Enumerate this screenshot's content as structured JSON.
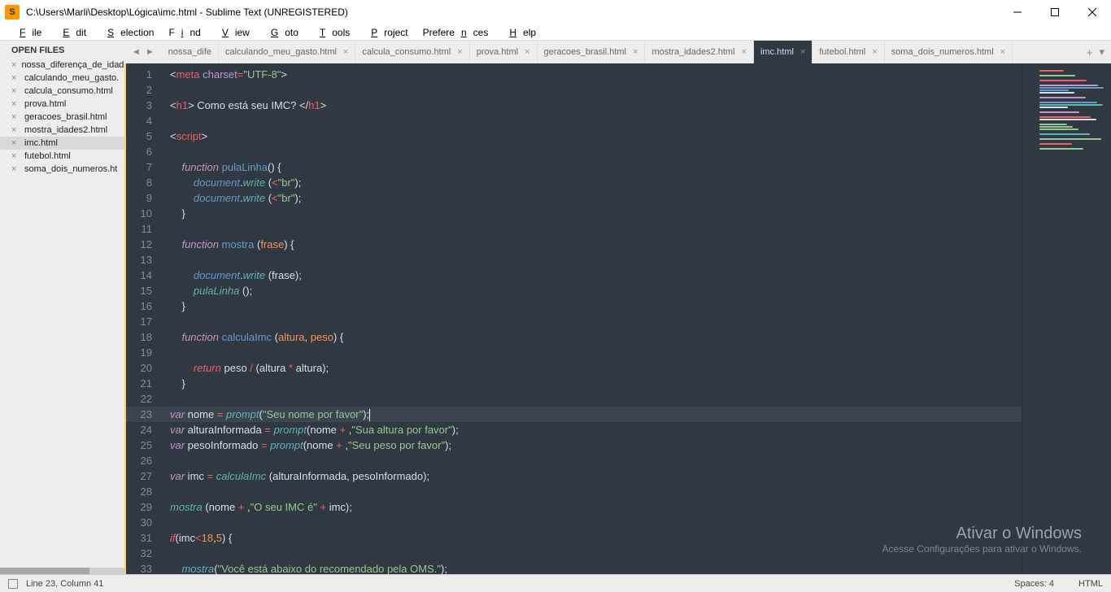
{
  "titlebar": {
    "path": "C:\\Users\\Marli\\Desktop\\Lógica\\imc.html - Sublime Text (UNREGISTERED)"
  },
  "menu": {
    "items": [
      "File",
      "Edit",
      "Selection",
      "Find",
      "View",
      "Goto",
      "Tools",
      "Project",
      "Preferences",
      "Help"
    ]
  },
  "sidebar": {
    "header": "OPEN FILES",
    "files": [
      {
        "name": "nossa_diferença_de_idade",
        "active": false
      },
      {
        "name": "calculando_meu_gasto.",
        "active": false
      },
      {
        "name": "calcula_consumo.html",
        "active": false
      },
      {
        "name": "prova.html",
        "active": false
      },
      {
        "name": "geracoes_brasil.html",
        "active": false
      },
      {
        "name": "mostra_idades2.html",
        "active": false
      },
      {
        "name": "imc.html",
        "active": true
      },
      {
        "name": "futebol.html",
        "active": false
      },
      {
        "name": "soma_dois_numeros.ht",
        "active": false
      }
    ]
  },
  "tabs": {
    "items": [
      {
        "label": "nossa_dife",
        "active": false,
        "closable": false
      },
      {
        "label": "calculando_meu_gasto.html",
        "active": false,
        "closable": true
      },
      {
        "label": "calcula_consumo.html",
        "active": false,
        "closable": true
      },
      {
        "label": "prova.html",
        "active": false,
        "closable": true
      },
      {
        "label": "geracoes_brasil.html",
        "active": false,
        "closable": true
      },
      {
        "label": "mostra_idades2.html",
        "active": false,
        "closable": true
      },
      {
        "label": "imc.html",
        "active": true,
        "closable": true
      },
      {
        "label": "futebol.html",
        "active": false,
        "closable": true
      },
      {
        "label": "soma_dois_numeros.html",
        "active": false,
        "closable": true
      }
    ]
  },
  "code": {
    "current_line": 23,
    "lines_start": 1,
    "lines_end": 33
  },
  "watermark": {
    "title": "Ativar o Windows",
    "subtitle": "Acesse Configurações para ativar o Windows."
  },
  "statusbar": {
    "position": "Line 23, Column 41",
    "spaces": "Spaces: 4",
    "syntax": "HTML"
  }
}
